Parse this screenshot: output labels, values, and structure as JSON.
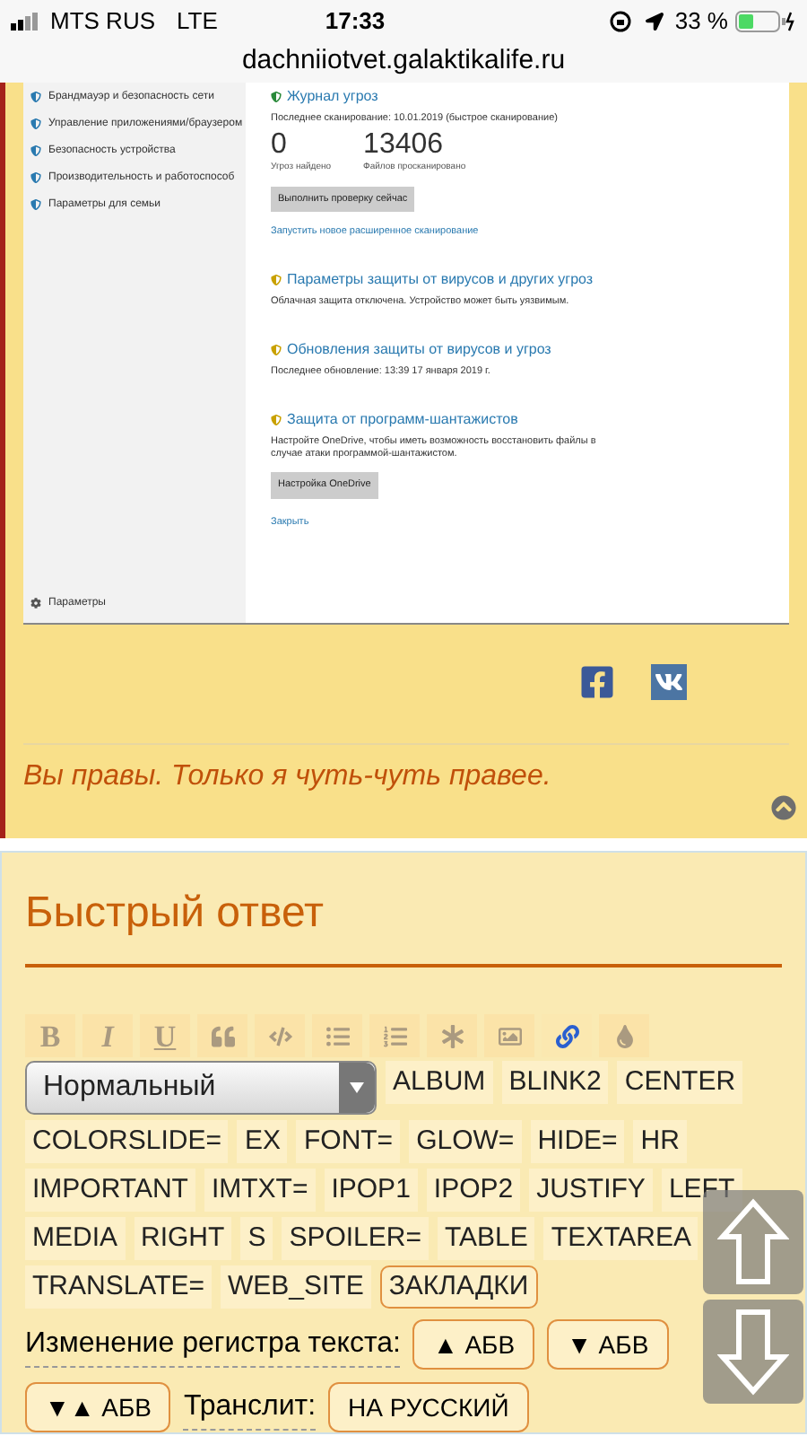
{
  "status_bar": {
    "carrier": "MTS RUS",
    "network": "LTE",
    "time": "17:33",
    "battery": "33 %"
  },
  "address_bar": {
    "url": "dachniiotvet.galaktikalife.ru"
  },
  "post": {
    "screenshot": {
      "sidebar": [
        {
          "label": "Брандмауэр и безопасность сети"
        },
        {
          "label": "Управление приложениями/браузером"
        },
        {
          "label": "Безопасность устройства"
        },
        {
          "label": "Производительность и работоспособ"
        },
        {
          "label": "Параметры для семьи"
        }
      ],
      "settings": "Параметры",
      "history_title": "Журнал угроз",
      "last_scan": "Последнее сканирование: 10.01.2019 (быстрое сканирование)",
      "stats": [
        {
          "value": "0",
          "label": "Угроз найдено"
        },
        {
          "value": "13406",
          "label": "Файлов просканировано"
        }
      ],
      "scan_button": "Выполнить проверку сейчас",
      "advanced_link": "Запустить новое расширенное сканирование",
      "sections": [
        {
          "title": "Параметры защиты от вирусов и других угроз",
          "text": "Облачная защита отключена. Устройство может быть уязвимым."
        },
        {
          "title": "Обновления защиты от вирусов и угроз",
          "text": "Последнее обновление: 13:39 17 января 2019 г."
        },
        {
          "title": "Защита от программ-шантажистов",
          "text": "Настройте OneDrive, чтобы иметь возможность восстановить файлы в случае атаки программой-шантажистом.",
          "button": "Настройка OneDrive"
        }
      ],
      "close_link": "Закрыть"
    },
    "signature": "Вы правы. Только я чуть-чуть правее."
  },
  "quick_reply": {
    "title": "Быстрый ответ",
    "format_buttons": [
      "B",
      "I",
      "U"
    ],
    "style_select": "Нормальный",
    "tags": [
      {
        "label": "ALBUM",
        "kind": "plain"
      },
      {
        "label": "BLINK2",
        "kind": "plain"
      },
      {
        "label": "CENTER",
        "kind": "plain"
      },
      {
        "label": "COLORSLIDE=",
        "kind": "plain"
      },
      {
        "label": "EX",
        "kind": "plain"
      },
      {
        "label": "FONT=",
        "kind": "plain"
      },
      {
        "label": "GLOW=",
        "kind": "plain"
      },
      {
        "label": "HIDE=",
        "kind": "plain"
      },
      {
        "label": "HR",
        "kind": "plain"
      },
      {
        "label": "IMPORTANT",
        "kind": "plain"
      },
      {
        "label": "IMTXT=",
        "kind": "plain"
      },
      {
        "label": "IPOP1",
        "kind": "plain"
      },
      {
        "label": "IPOP2",
        "kind": "plain"
      },
      {
        "label": "JUSTIFY",
        "kind": "plain"
      },
      {
        "label": "LEFT",
        "kind": "plain"
      },
      {
        "label": "MEDIA",
        "kind": "plain"
      },
      {
        "label": "RIGHT",
        "kind": "plain"
      },
      {
        "label": "S",
        "kind": "plain"
      },
      {
        "label": "SPOILER=",
        "kind": "plain"
      },
      {
        "label": "TABLE",
        "kind": "plain"
      },
      {
        "label": "TEXTAREA",
        "kind": "plain"
      },
      {
        "label": "TRANSLATE=",
        "kind": "plain"
      },
      {
        "label": "WEB_SITE",
        "kind": "plain"
      },
      {
        "label": "ЗАКЛАДКИ",
        "kind": "outlined"
      }
    ],
    "case_label": "Изменение регистра текста:",
    "case_buttons": [
      "▲ АБВ",
      "▼ АБВ",
      "▼▲ АБВ"
    ],
    "translit_label": "Транслит:",
    "translit_button": "НА РУССКИЙ"
  }
}
